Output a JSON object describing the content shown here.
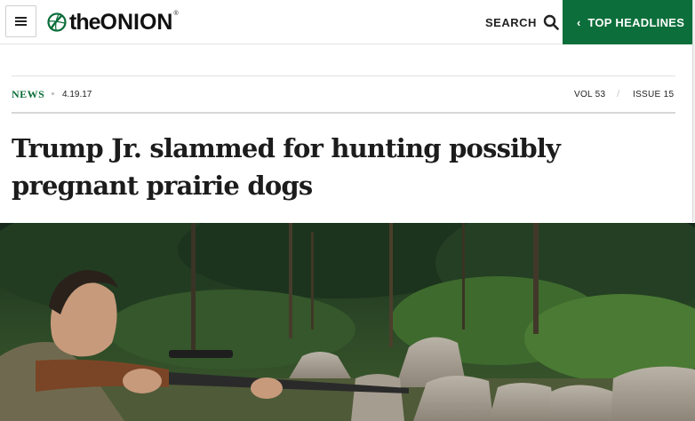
{
  "header": {
    "menu_icon": "hamburger-menu-icon",
    "logo": {
      "the": "the",
      "onion": "ONION",
      "reg": "®"
    },
    "search_label": "SEARCH",
    "search_icon": "search-icon",
    "top_headlines_label": "TOP HEADLINES",
    "top_headlines_icon": "chevron-left-icon",
    "colors": {
      "brand_green": "#0c6e3a"
    }
  },
  "article": {
    "section": "NEWS",
    "date": "4.19.17",
    "volume": "VOL 53",
    "separator": "/",
    "issue": "ISSUE 15",
    "headline": "Trump Jr. slammed for hunting possibly pregnant prairie dogs"
  },
  "hero_image": {
    "subject": "man aiming rifle in forest"
  }
}
